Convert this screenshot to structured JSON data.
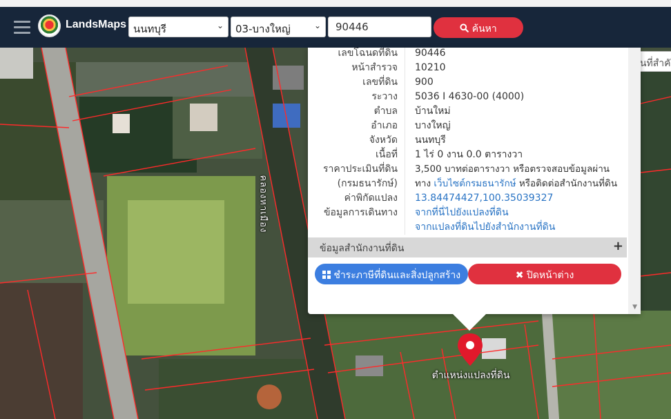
{
  "app": {
    "brand": "LandsMaps",
    "province": "นนทบุรี",
    "district": "03-บางใหญ่",
    "deed_no": "90446",
    "search_btn": "ค้นหา"
  },
  "map": {
    "place_search_placeholder": "ค้นหาสถานที่สำคัญ",
    "marker_label": "ตำแหน่งแปลงที่ดิน",
    "road_label": "คลองหาเมือง"
  },
  "popup": {
    "rows": [
      {
        "key": "เลขโฉนดที่ดิน",
        "value": "90446"
      },
      {
        "key": "หน้าสำรวจ",
        "value": "10210"
      },
      {
        "key": "เลขที่ดิน",
        "value": "900"
      },
      {
        "key": "ระวาง",
        "value": "5036 I 4630-00 (4000)"
      },
      {
        "key": "ตำบล",
        "value": "บ้านใหม่"
      },
      {
        "key": "อำเภอ",
        "value": "บางใหญ่"
      },
      {
        "key": "จังหวัด",
        "value": "นนทบุรี"
      },
      {
        "key": "เนื้อที่",
        "value": "1 ไร่ 0 งาน 0.0 ตารางวา"
      }
    ],
    "price_key": "ราคาประเมินที่ดิน",
    "price_key2": "(กรมธนารักษ์)",
    "price_line1": "3,500 บาทต่อตารางวา หรือตรวจสอบข้อมูลผ่าน",
    "price_line2a": "ทาง",
    "price_link": "เว็บไซต์กรมธนารักษ์",
    "price_line2b": "หรือติดต่อสำนักงานที่ดิน",
    "coord_key": "ค่าพิกัดแปลง",
    "coord_value": "13.84474427,100.35039327",
    "travel_key": "ข้อมูลการเดินทาง",
    "travel_link1": "จากที่นี่ไปยังแปลงที่ดิน",
    "travel_link2": "จากแปลงที่ดินไปยังสำนักงานที่ดิน",
    "office_section": "ข้อมูลสำนักงานที่ดิน",
    "tax_btn": "ชำระภาษีที่ดินและสิ่งปลูกสร้าง",
    "close_btn": "ปิดหน้าต่าง"
  },
  "colors": {
    "topbar": "#17263a",
    "accent_red": "#e0313f",
    "accent_blue": "#3c7ee0",
    "link": "#2873c4",
    "parcel_line": "#ff2a2a"
  },
  "icons": {
    "menu": "hamburger-icon",
    "search": "search-icon",
    "tax": "grid-icon",
    "close": "close-icon",
    "expand": "plus-icon",
    "marker": "map-pin-icon"
  }
}
